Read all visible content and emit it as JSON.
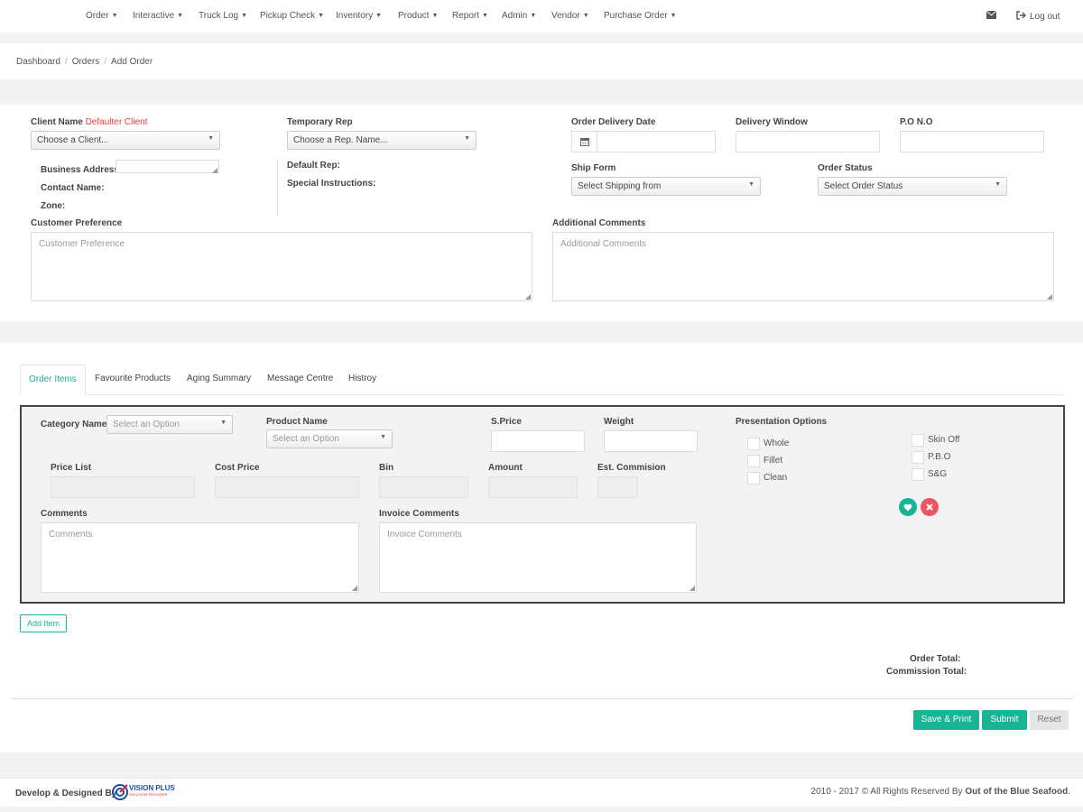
{
  "nav": {
    "items": [
      "Order",
      "Interactive",
      "Truck Log",
      "Pickup Check",
      "Inventory",
      "Product",
      "Report",
      "Admin",
      "Vendor",
      "Purchase Order"
    ],
    "logout": "Log out"
  },
  "breadcrumb": [
    "Dashboard",
    "Orders",
    "Add Order"
  ],
  "order_form": {
    "client_name_label": "Client Name",
    "defaulter_text": "Defaulter Client",
    "client_select": "Choose a Client...",
    "business_address_label": "Business Address:",
    "contact_name_label": "Contact Name:",
    "zone_label": "Zone:",
    "temporary_rep_label": "Temporary Rep",
    "rep_select": "Choose a Rep. Name...",
    "default_rep_label": "Default Rep:",
    "special_instructions_label": "Special Instructions:",
    "order_delivery_date_label": "Order Delivery Date",
    "delivery_window_label": "Delivery Window",
    "pono_label": "P.O N.O",
    "ship_form_label": "Ship Form",
    "ship_select": "Select Shipping from",
    "order_status_label": "Order Status",
    "order_status_select": "Select Order Status",
    "customer_preference_label": "Customer Preference",
    "customer_preference_placeholder": "Customer Preference",
    "additional_comments_label": "Additional Comments",
    "additional_comments_placeholder": "Additional Comments"
  },
  "tabs": [
    "Order Items",
    "Favourite Products",
    "Aging Summary",
    "Message Centre",
    "Histroy"
  ],
  "item_form": {
    "category_name_label": "Category Name",
    "category_select": "Select an Option",
    "product_name_label": "Product Name",
    "product_select": "Select an Option",
    "sprice_label": "S.Price",
    "weight_label": "Weight",
    "presentation_options_label": "Presentation Options",
    "options_left": [
      "Whole",
      "Fillet",
      "Clean"
    ],
    "options_right": [
      "Skin Off",
      "P.B.O",
      "S&G"
    ],
    "price_list_label": "Price List",
    "cost_price_label": "Cost Price",
    "bin_label": "Bin",
    "amount_label": "Amount",
    "est_commission_label": "Est. Commision",
    "comments_label": "Comments",
    "comments_placeholder": "Comments",
    "invoice_comments_label": "Invoice Comments",
    "invoice_comments_placeholder": "Invoice Comments"
  },
  "add_item_button": "Add Item",
  "totals": {
    "order_total_label": "Order Total:",
    "commission_total_label": "Commission Total:"
  },
  "buttons": {
    "save_print": "Save & Print",
    "submit": "Submit",
    "reset": "Reset"
  },
  "footer": {
    "develop_text": "Develop & Designed By",
    "logo_text": "VISION PLUS",
    "logo_subtext": "SOLUTION PROVIDER",
    "copyright_prefix": "2010 - 2017 © All Rights Reserved By ",
    "company": "Out of the Blue Seafood",
    "period": "."
  },
  "colors": {
    "accent": "#1ab394",
    "danger": "#ed5565",
    "logo_blue": "#1c4fa3",
    "logo_red": "#e02b2b"
  }
}
